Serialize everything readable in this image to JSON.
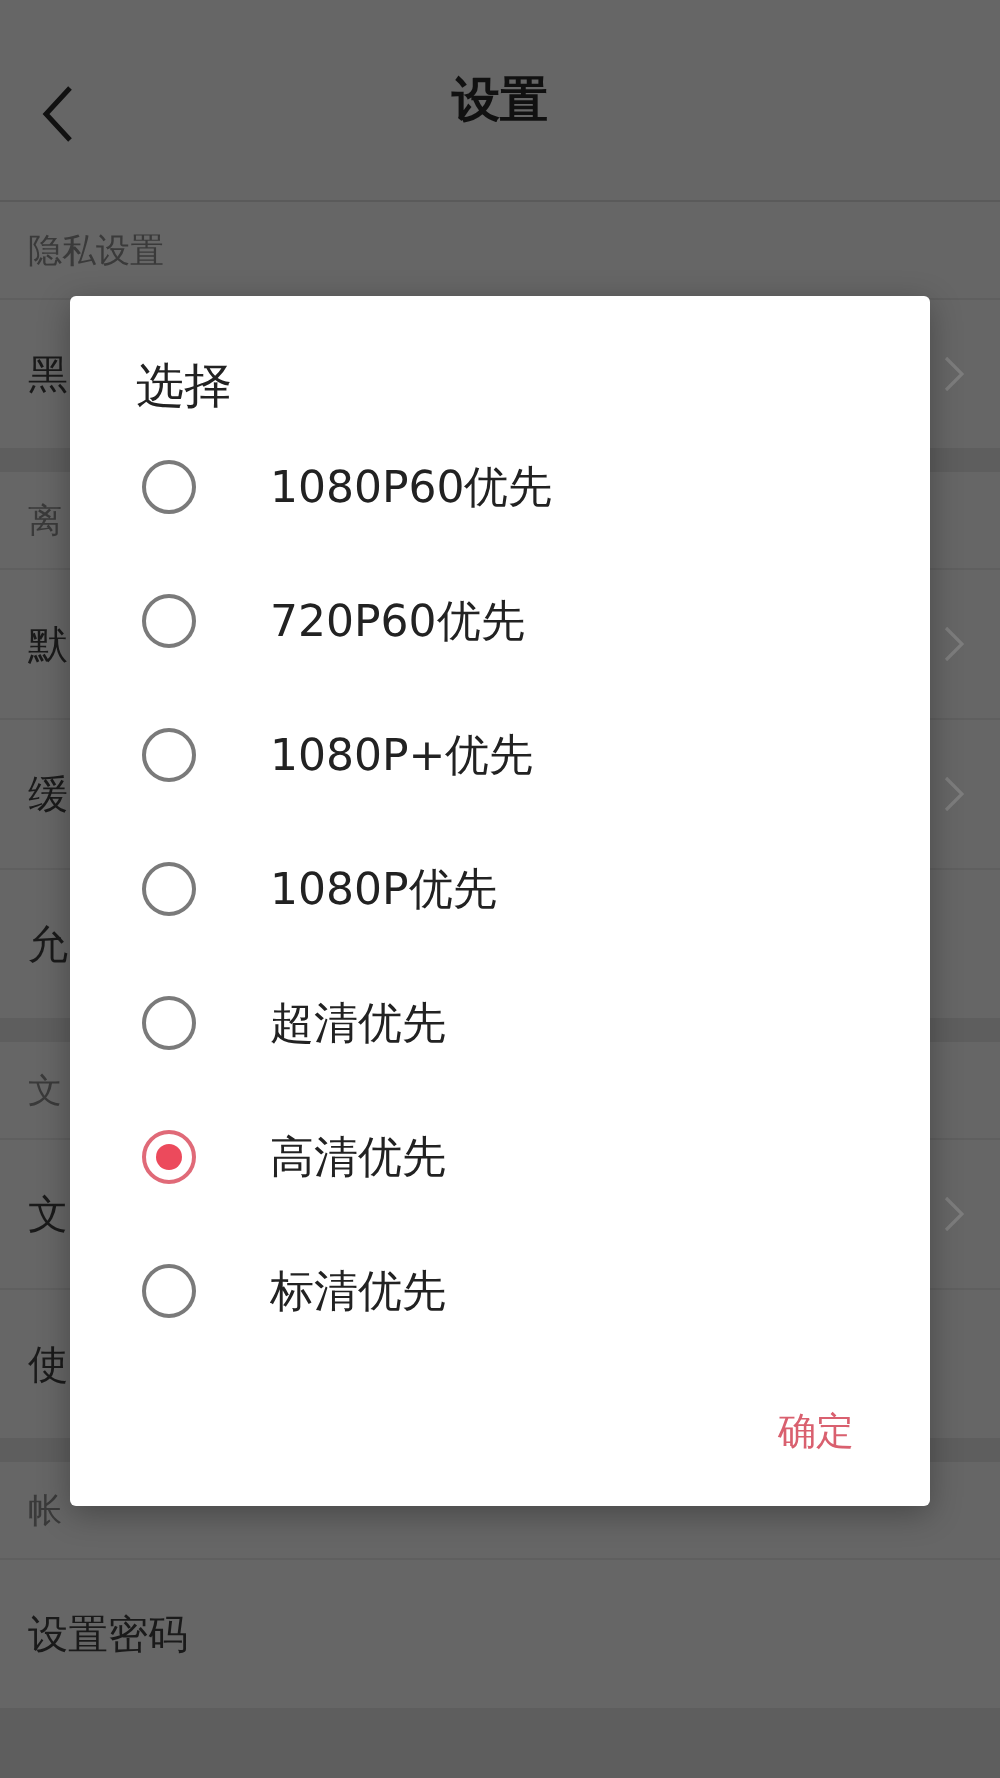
{
  "page": {
    "title": "设置",
    "sections": [
      {
        "header": "隐私设置",
        "rows": [
          {
            "label": "黑",
            "chevron": true
          }
        ]
      },
      {
        "header": "离",
        "rows": [
          {
            "label": "默",
            "chevron": true
          },
          {
            "label": "缓",
            "chevron": true
          },
          {
            "label": "允",
            "chevron": false
          }
        ]
      },
      {
        "header": "文",
        "rows": [
          {
            "label": "文",
            "chevron": true
          },
          {
            "label": "使",
            "chevron": false
          }
        ]
      },
      {
        "header": "帐",
        "rows": [
          {
            "label": "设置密码",
            "chevron": false
          }
        ]
      }
    ]
  },
  "dialog": {
    "title": "选择",
    "options": [
      {
        "label": "1080P60优先",
        "selected": false
      },
      {
        "label": "720P60优先",
        "selected": false
      },
      {
        "label": "1080P+优先",
        "selected": false
      },
      {
        "label": "1080P优先",
        "selected": false
      },
      {
        "label": "超清优先",
        "selected": false
      },
      {
        "label": "高清优先",
        "selected": true
      },
      {
        "label": "标清优先",
        "selected": false
      }
    ],
    "confirm": "确定"
  }
}
